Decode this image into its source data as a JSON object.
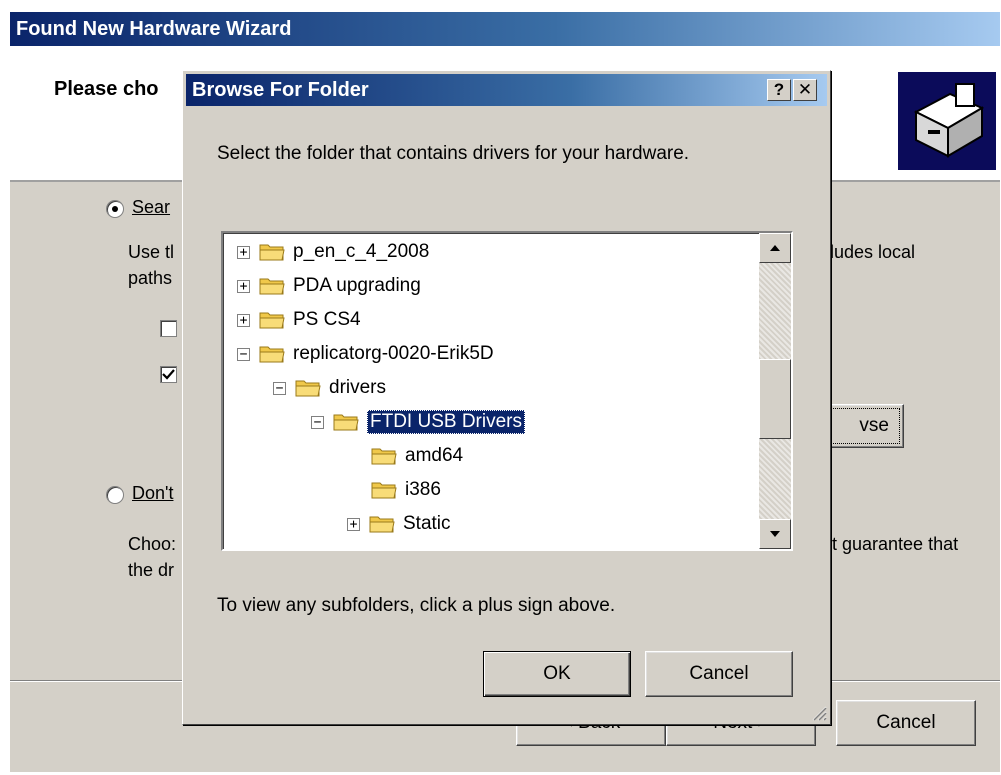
{
  "wizard": {
    "title": "Found New Hardware Wizard",
    "header_title": "Please cho",
    "option1_label": "Sear",
    "option1_desc1": "Use tl",
    "option1_desc2": "paths",
    "desc_right": "ludes local",
    "browse_fragment": "vse",
    "option2_label": "Don't",
    "option2_desc1": "Choo:",
    "option2_desc2": "the dr",
    "guarantee_fragment": "t guarantee that",
    "back_label": "< Back",
    "next_label": "Next >",
    "cancel_label": "Cancel"
  },
  "dialog": {
    "title": "Browse For Folder",
    "help_label": "?",
    "close_label": "✕",
    "instruction": "Select the folder that contains drivers for your hardware.",
    "hint": "To view any subfolders, click a plus sign above.",
    "ok_label": "OK",
    "cancel_label": "Cancel",
    "tree": [
      {
        "label": "p_en_c_4_2008",
        "expander": "+"
      },
      {
        "label": "PDA upgrading",
        "expander": "+"
      },
      {
        "label": "PS CS4",
        "expander": "+"
      },
      {
        "label": "replicatorg-0020-Erik5D",
        "expander": "−"
      },
      {
        "label": "drivers",
        "expander": "−"
      },
      {
        "label": "FTDI USB Drivers",
        "expander": "−",
        "selected": true
      },
      {
        "label": "amd64",
        "expander": ""
      },
      {
        "label": "i386",
        "expander": ""
      },
      {
        "label": "Static",
        "expander": "+"
      }
    ]
  },
  "colors": {
    "title_bar": "#0a246a",
    "selection": "#0a246a",
    "folder": "#f0c84a",
    "face": "#d4d0c8"
  }
}
